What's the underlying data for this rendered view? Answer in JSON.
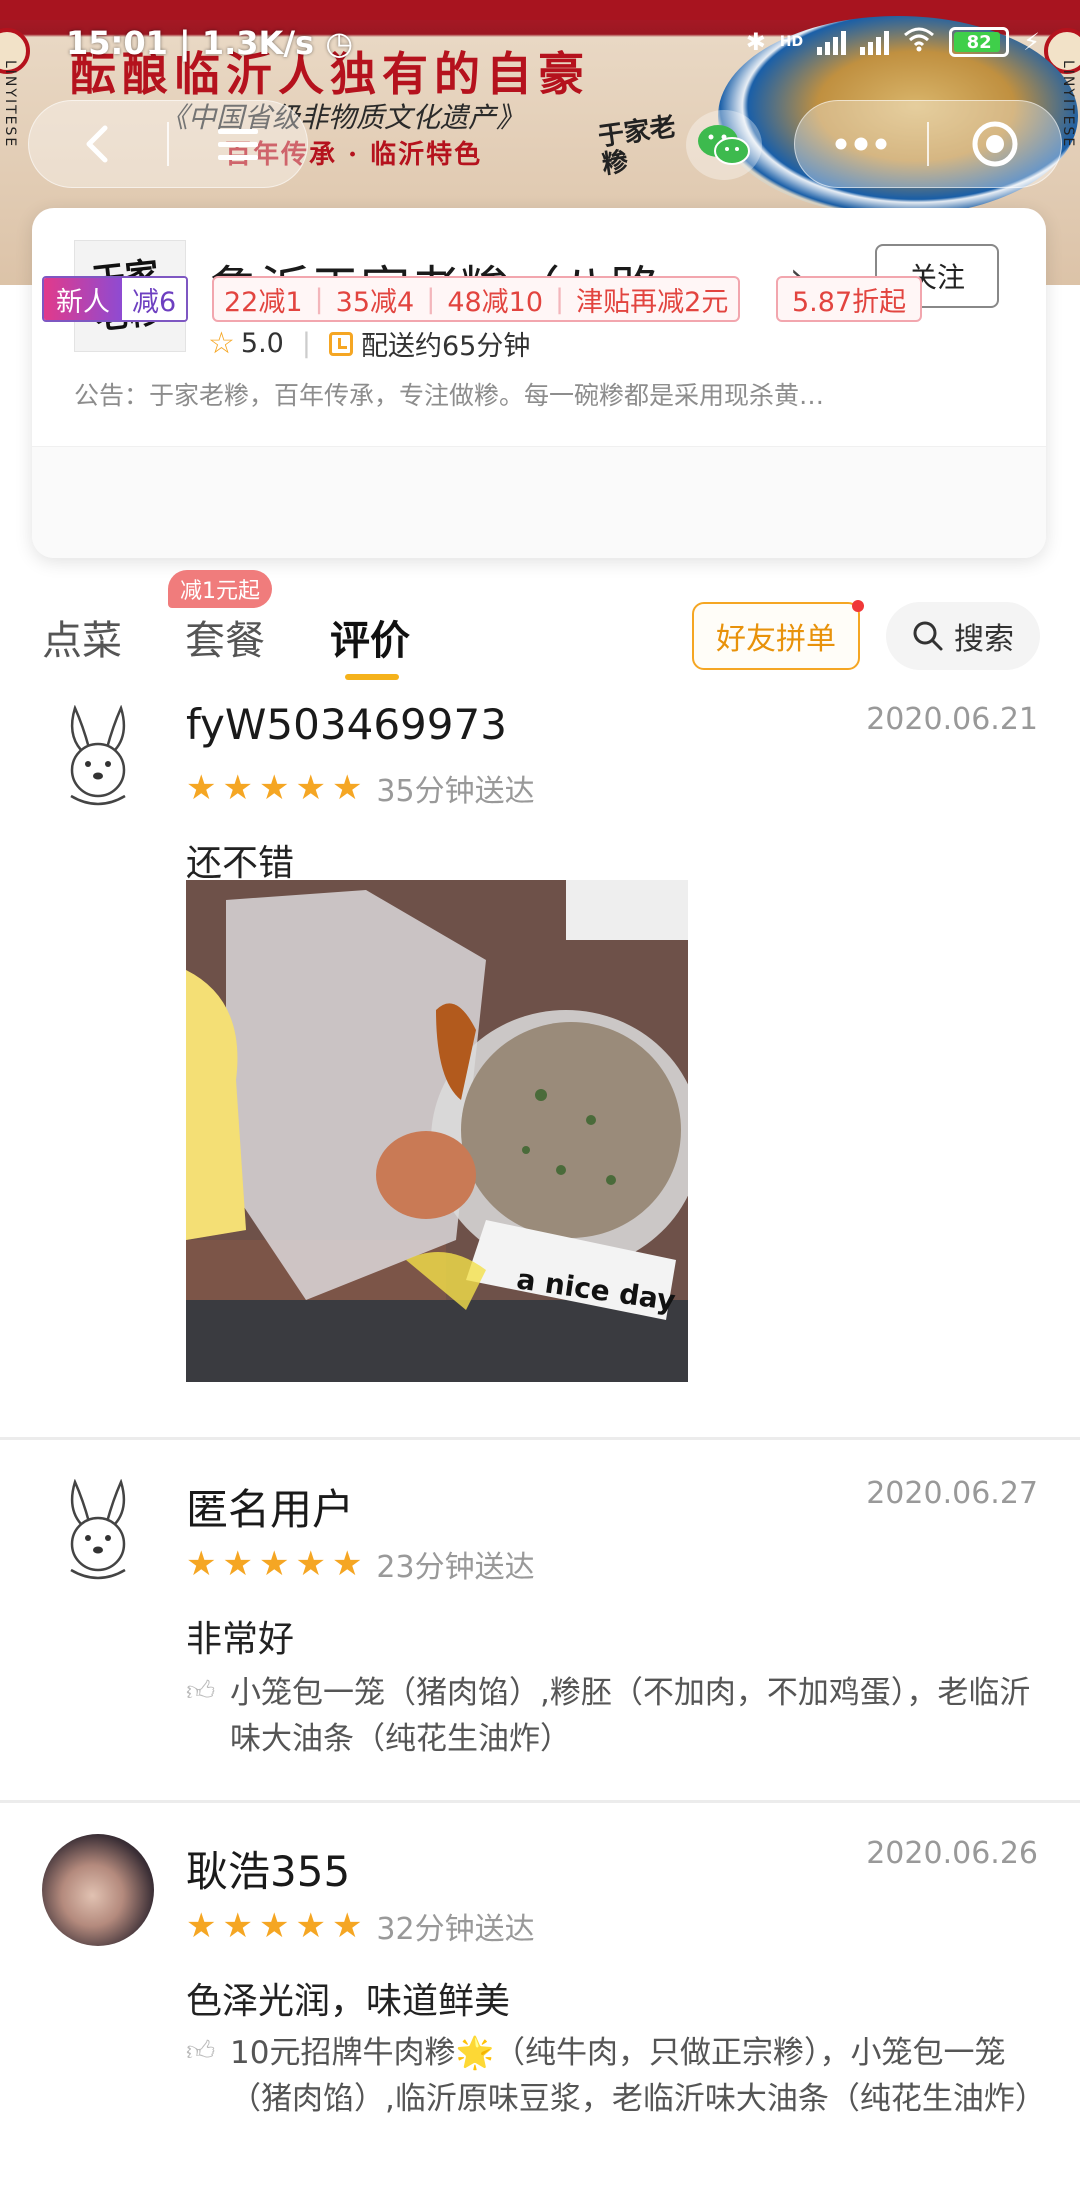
{
  "banner": {
    "slogan": "酝酿临沂人独有的自豪",
    "subtitle": "《中国省级非物质文化遗产》",
    "tagline": "百年传承 · 临沂特色",
    "brand": "于家老糁",
    "side_text": "LINYITESE"
  },
  "status_bar": {
    "time": "15:01",
    "speed": "1.3K/s",
    "battery": "82",
    "network": "HD"
  },
  "store": {
    "name": "鲁沂于家老糁（八路…",
    "follow_label": "关注",
    "rating": "5.0",
    "delivery": "配送约65分钟",
    "notice": "公告：于家老糁，百年传承，专注做糁。每一碗糁都是采用现杀黄…",
    "promos": {
      "new_user": "新人",
      "new_user_discount": "减6",
      "full_reductions": [
        "22减1",
        "35减4",
        "48减10",
        "津贴再减2元"
      ],
      "discount": "5.87折起"
    }
  },
  "tabs": {
    "dish": "点菜",
    "set_meal": "套餐",
    "set_meal_badge": "减1元起",
    "review": "评价",
    "friend_order": "好友拼单",
    "search": "搜索"
  },
  "reviews": [
    {
      "user": "fyW503469973",
      "date": "2020.06.21",
      "stars": 5,
      "delivery_time": "35分钟送达",
      "text": "还不错",
      "photo_caption": "a nice day"
    },
    {
      "user": "匿名用户",
      "date": "2020.06.27",
      "stars": 5,
      "delivery_time": "23分钟送达",
      "text": "非常好",
      "liked_items": "小笼包一笼（猪肉馅）,糁胚（不加肉，不加鸡蛋），老临沂味大油条（纯花生油炸）"
    },
    {
      "user": "耿浩355",
      "date": "2020.06.26",
      "stars": 5,
      "delivery_time": "32分钟送达",
      "text": "色泽光润，味道鲜美",
      "liked_items": "10元招牌牛肉糁🌟（纯牛肉，只做正宗糁），小笼包一笼（猪肉馅）,临沂原味豆浆，老临沂味大油条（纯花生油炸）"
    }
  ]
}
